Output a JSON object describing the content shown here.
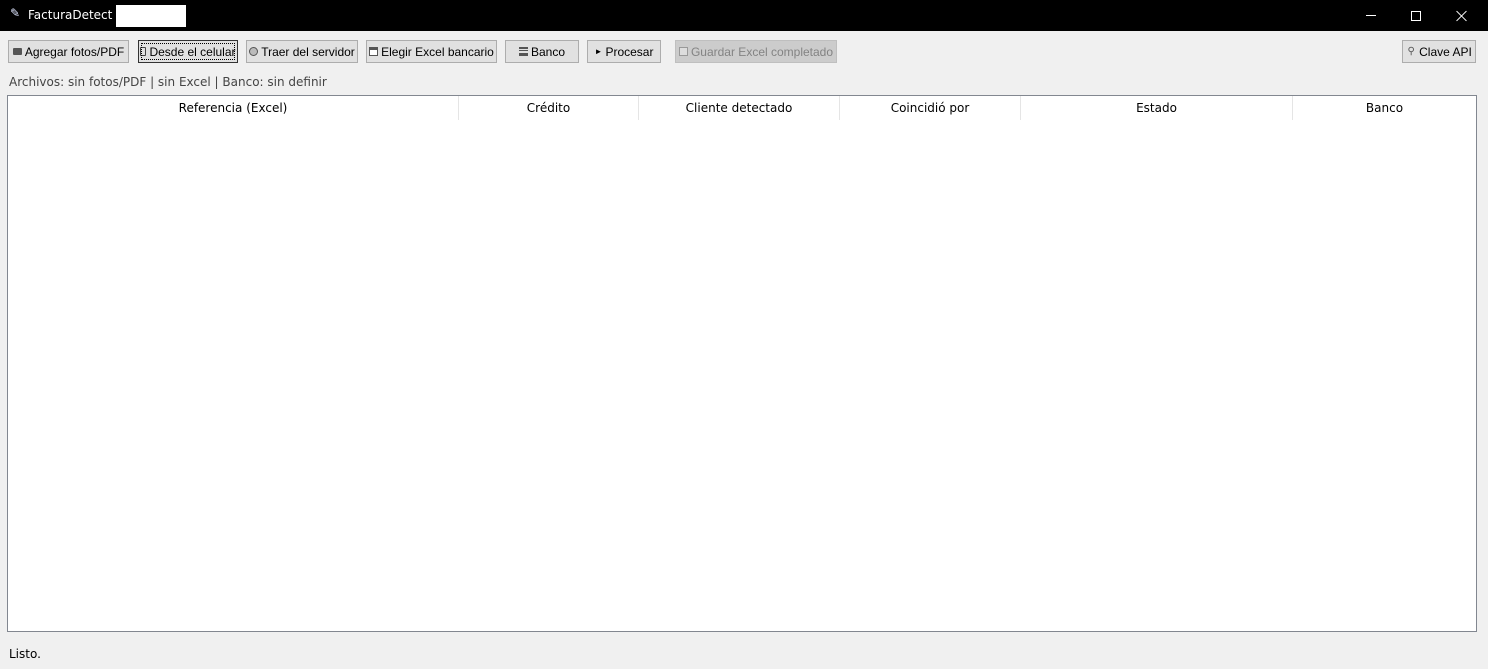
{
  "window": {
    "title": "FacturaDetect —",
    "app_icon": "feather-icon",
    "controls": [
      "minimize-icon",
      "maximize-icon",
      "close-icon"
    ]
  },
  "toolbar": {
    "add_files": "Agregar fotos/PDF",
    "from_phone": "Desde el celular",
    "from_server": "Traer del servidor",
    "choose_excel": "Elegir Excel bancario",
    "bank": "Banco",
    "process": "Procesar",
    "save_excel": "Guardar Excel completado",
    "api_key": "Clave API"
  },
  "status": {
    "files": "Archivos: sin fotos/PDF  |  sin Excel  |  Banco: sin definir"
  },
  "table": {
    "columns": [
      "Referencia (Excel)",
      "Crédito",
      "Cliente detectado",
      "Coincidió por",
      "Estado",
      "Banco"
    ],
    "rows": []
  },
  "footer": {
    "message": "Listo."
  },
  "colors": {
    "titlebar": "#000000",
    "background": "#f0f0f0",
    "button": "#e1e1e1",
    "disabled_button": "#cccccc"
  }
}
